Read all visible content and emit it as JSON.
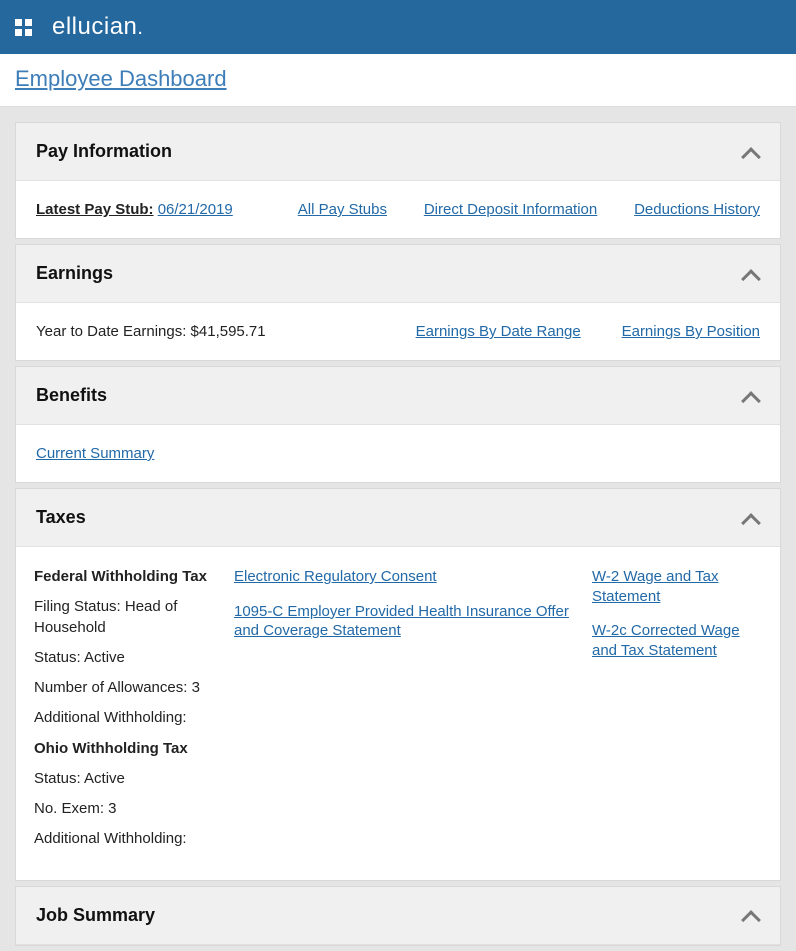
{
  "header": {
    "brand": "ellucian",
    "dot": "."
  },
  "breadcrumb": {
    "label": "Employee Dashboard"
  },
  "payInfo": {
    "title": "Pay Information",
    "latestLabel": "Latest Pay Stub:",
    "latestDate": "06/21/2019",
    "allStubs": "All Pay Stubs",
    "directDeposit": "Direct Deposit Information",
    "deductions": "Deductions History"
  },
  "earnings": {
    "title": "Earnings",
    "ytdText": "Year to Date Earnings: $41,595.71",
    "byDateRange": "Earnings By Date Range",
    "byPosition": "Earnings By Position"
  },
  "benefits": {
    "title": "Benefits",
    "currentSummary": "Current Summary"
  },
  "taxes": {
    "title": "Taxes",
    "federalHeading": "Federal Withholding Tax",
    "filingStatusLabel": "Filing Status: Head of Household",
    "statusActive1": "Status: Active",
    "allowances": "Number of Allowances: 3",
    "addlWithholding1": "Additional Withholding:",
    "ohioHeading": "Ohio Withholding Tax",
    "statusActive2": "Status: Active",
    "noExem": "No. Exem: 3",
    "addlWithholding2": "Additional Withholding:",
    "elecRegConsent": "Electronic Regulatory Consent",
    "ten95c": "1095-C Employer Provided Health Insurance Offer and Coverage Statement",
    "w2": "W-2 Wage and Tax Statement",
    "w2c": "W-2c Corrected Wage and Tax Statement"
  },
  "jobSummary": {
    "title": "Job Summary"
  }
}
